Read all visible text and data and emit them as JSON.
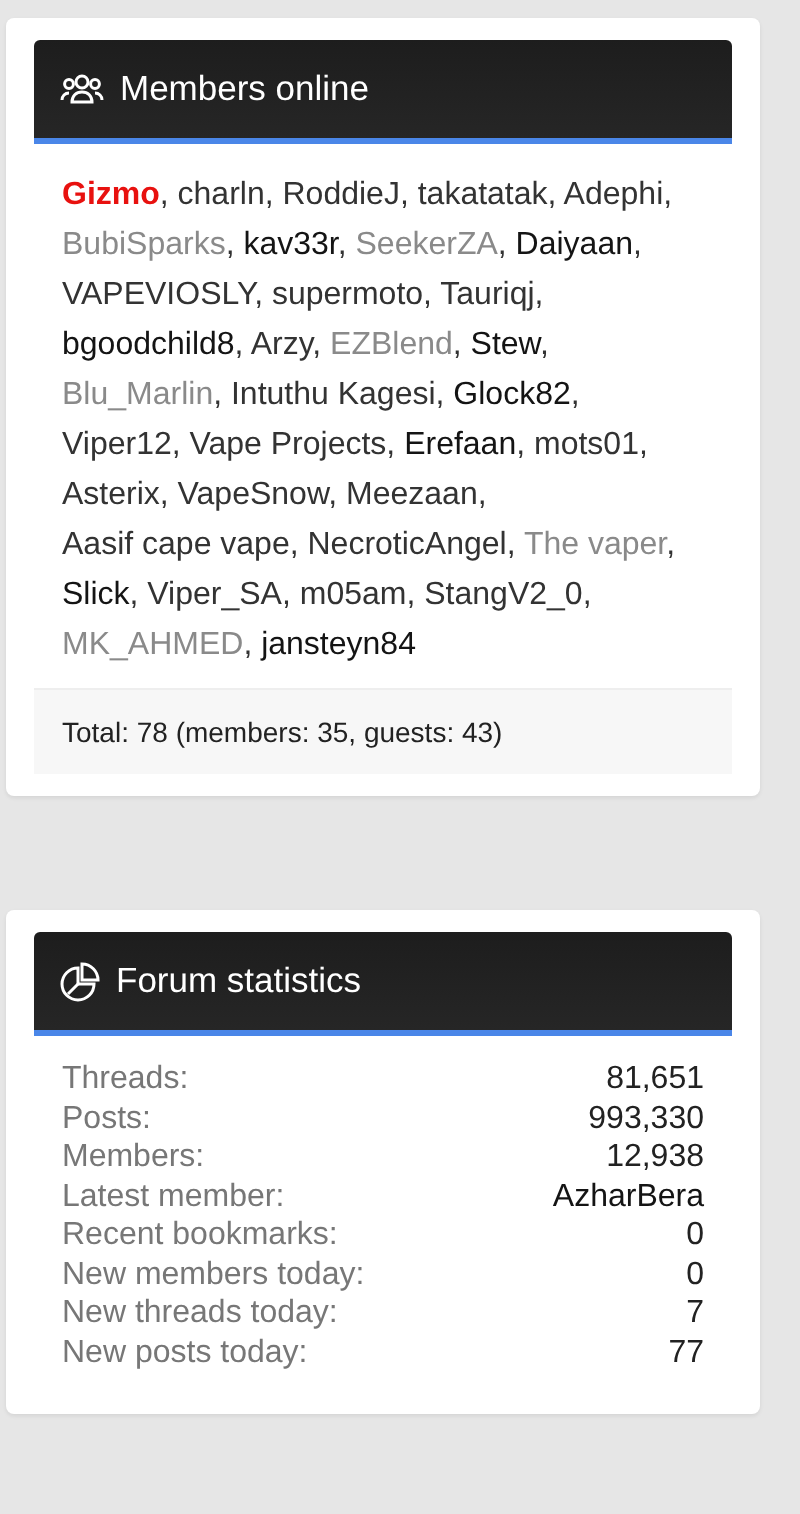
{
  "members_online": {
    "title": "Members online",
    "separator": ", ",
    "members": [
      {
        "name": "Gizmo",
        "kind": "staff",
        "color": "#e8110f"
      },
      {
        "name": "charln",
        "kind": "member",
        "color": "#333333"
      },
      {
        "name": "RoddieJ",
        "kind": "member",
        "color": "#333333"
      },
      {
        "name": "takatatak",
        "kind": "member",
        "color": "#333333"
      },
      {
        "name": "Adephi",
        "kind": "member",
        "color": "#333333"
      },
      {
        "name": "BubiSparks",
        "kind": "member",
        "color": "#8a8a8a"
      },
      {
        "name": "kav33r",
        "kind": "member",
        "color": "#141414"
      },
      {
        "name": "SeekerZA",
        "kind": "member",
        "color": "#8a8a8a"
      },
      {
        "name": "Daiyaan",
        "kind": "member",
        "color": "#141414"
      },
      {
        "name": "VAPEVIOSLY",
        "kind": "member",
        "color": "#333333"
      },
      {
        "name": "supermoto",
        "kind": "member",
        "color": "#333333"
      },
      {
        "name": "Tauriqj",
        "kind": "member",
        "color": "#333333"
      },
      {
        "name": "bgoodchild8",
        "kind": "member",
        "color": "#141414"
      },
      {
        "name": "Arzy",
        "kind": "member",
        "color": "#333333"
      },
      {
        "name": "EZBlend",
        "kind": "member",
        "color": "#8a8a8a"
      },
      {
        "name": "Stew",
        "kind": "member",
        "color": "#141414"
      },
      {
        "name": "Blu_Marlin",
        "kind": "member",
        "color": "#8a8a8a"
      },
      {
        "name": "Intuthu Kagesi",
        "kind": "member",
        "color": "#333333"
      },
      {
        "name": "Glock82",
        "kind": "member",
        "color": "#141414"
      },
      {
        "name": "Viper12",
        "kind": "member",
        "color": "#333333"
      },
      {
        "name": "Vape Projects",
        "kind": "member",
        "color": "#333333"
      },
      {
        "name": "Erefaan",
        "kind": "member",
        "color": "#141414"
      },
      {
        "name": "mots01",
        "kind": "member",
        "color": "#333333"
      },
      {
        "name": "Asterix",
        "kind": "member",
        "color": "#333333"
      },
      {
        "name": "VapeSnow",
        "kind": "member",
        "color": "#333333"
      },
      {
        "name": "Meezaan",
        "kind": "member",
        "color": "#333333"
      },
      {
        "name": "Aasif cape vape",
        "kind": "member",
        "color": "#333333"
      },
      {
        "name": "NecroticAngel",
        "kind": "member",
        "color": "#333333"
      },
      {
        "name": "The vaper",
        "kind": "member",
        "color": "#8a8a8a"
      },
      {
        "name": "Slick",
        "kind": "member",
        "color": "#141414"
      },
      {
        "name": "Viper_SA",
        "kind": "member",
        "color": "#333333"
      },
      {
        "name": "m05am",
        "kind": "member",
        "color": "#333333"
      },
      {
        "name": "StangV2_0",
        "kind": "member",
        "color": "#333333"
      },
      {
        "name": "MK_AHMED",
        "kind": "member",
        "color": "#8a8a8a"
      },
      {
        "name": "jansteyn84",
        "kind": "member",
        "color": "#141414"
      }
    ],
    "total": "Total: 78 (members: 35, guests: 43)"
  },
  "forum_statistics": {
    "title": "Forum statistics",
    "rows": [
      {
        "label": "Threads:",
        "value": "81,651"
      },
      {
        "label": "Posts:",
        "value": "993,330"
      },
      {
        "label": "Members:",
        "value": "12,938"
      },
      {
        "label": "Latest member:",
        "value": "AzharBera",
        "kind": "link"
      },
      {
        "label": "Recent bookmarks:",
        "value": "0"
      },
      {
        "label": "New members today:",
        "value": "0"
      },
      {
        "label": "New threads today:",
        "value": "7"
      },
      {
        "label": "New posts today:",
        "value": "77"
      }
    ]
  }
}
